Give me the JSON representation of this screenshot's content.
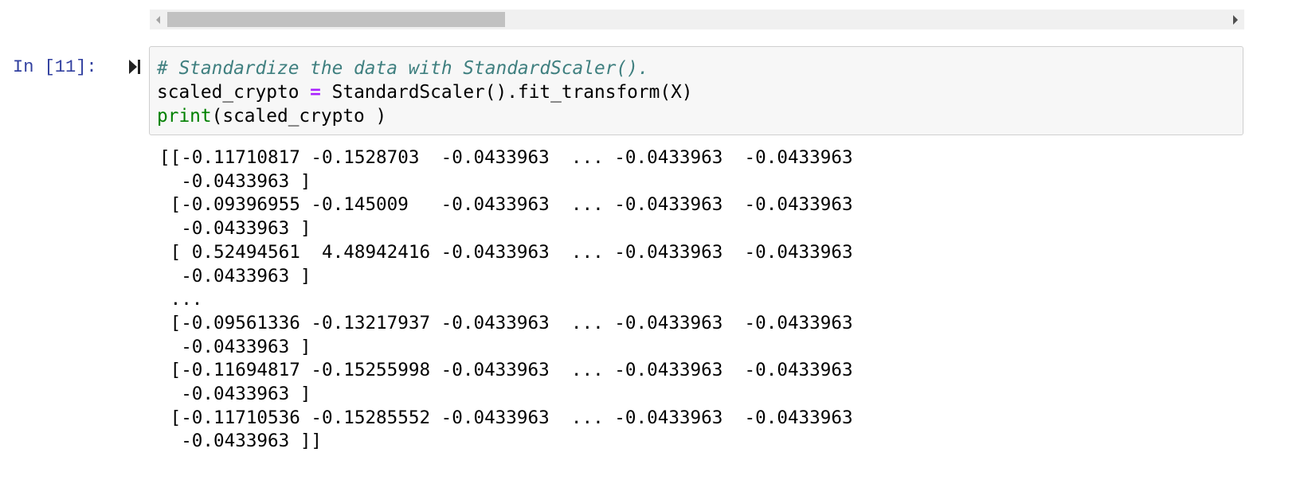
{
  "prompt": "In [11]:",
  "code": {
    "line1_comment": "# Standardize the data with StandardScaler().",
    "line2_var": "scaled_crypto ",
    "line2_op": "=",
    "line2_rest": " StandardScaler().fit_transform(X)",
    "line3_builtin": "print",
    "line3_rest": "(scaled_crypto )"
  },
  "output_lines": [
    "[[-0.11710817 -0.1528703  -0.0433963  ... -0.0433963  -0.0433963",
    "  -0.0433963 ]",
    " [-0.09396955 -0.145009   -0.0433963  ... -0.0433963  -0.0433963",
    "  -0.0433963 ]",
    " [ 0.52494561  4.48942416 -0.0433963  ... -0.0433963  -0.0433963",
    "  -0.0433963 ]",
    " ...",
    " [-0.09561336 -0.13217937 -0.0433963  ... -0.0433963  -0.0433963",
    "  -0.0433963 ]",
    " [-0.11694817 -0.15255998 -0.0433963  ... -0.0433963  -0.0433963",
    "  -0.0433963 ]",
    " [-0.11710536 -0.15285552 -0.0433963  ... -0.0433963  -0.0433963",
    "  -0.0433963 ]]"
  ],
  "icons": {
    "run": "run-cell-icon",
    "scroll_left": "arrow-left-icon",
    "scroll_right": "arrow-right-icon"
  },
  "colors": {
    "prompt": "#303f9f",
    "comment": "#408080",
    "operator": "#aa22ff",
    "builtin": "#008000",
    "cell_bg": "#f7f7f7"
  }
}
